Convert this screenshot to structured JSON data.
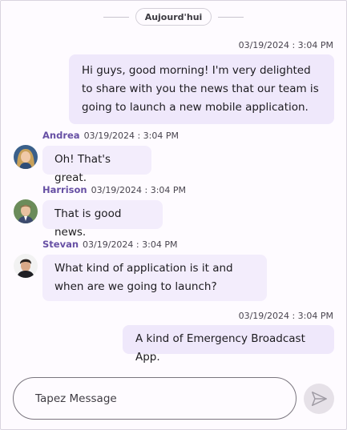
{
  "date_divider": "Aujourd'hui",
  "messages": [
    {
      "direction": "outgoing",
      "author": "",
      "time": "03/19/2024 : 3:04 PM",
      "text": "Hi guys, good morning! I'm very delighted to share with you the news that our team is going to launch a new mobile application."
    },
    {
      "direction": "incoming",
      "author": "Andrea",
      "time": "03/19/2024 : 3:04 PM",
      "text": "Oh! That's great.",
      "avatar_icon": "avatar-andrea"
    },
    {
      "direction": "incoming",
      "author": "Harrison",
      "time": "03/19/2024 : 3:04 PM",
      "text": "That is good news.",
      "avatar_icon": "avatar-harrison"
    },
    {
      "direction": "incoming",
      "author": "Stevan",
      "time": "03/19/2024 : 3:04 PM",
      "text": "What kind of application is it and when are we going to launch?",
      "avatar_icon": "avatar-stevan"
    },
    {
      "direction": "outgoing",
      "author": "",
      "time": "03/19/2024 : 3:04 PM",
      "text": "A kind of Emergency Broadcast App."
    }
  ],
  "composer": {
    "placeholder": "Tapez Message",
    "send_icon": "send-icon"
  },
  "colors": {
    "accent": "#6750a4",
    "bubble": "#f3edfc",
    "background": "#fefbff",
    "send_button": "#e6e1e8"
  }
}
